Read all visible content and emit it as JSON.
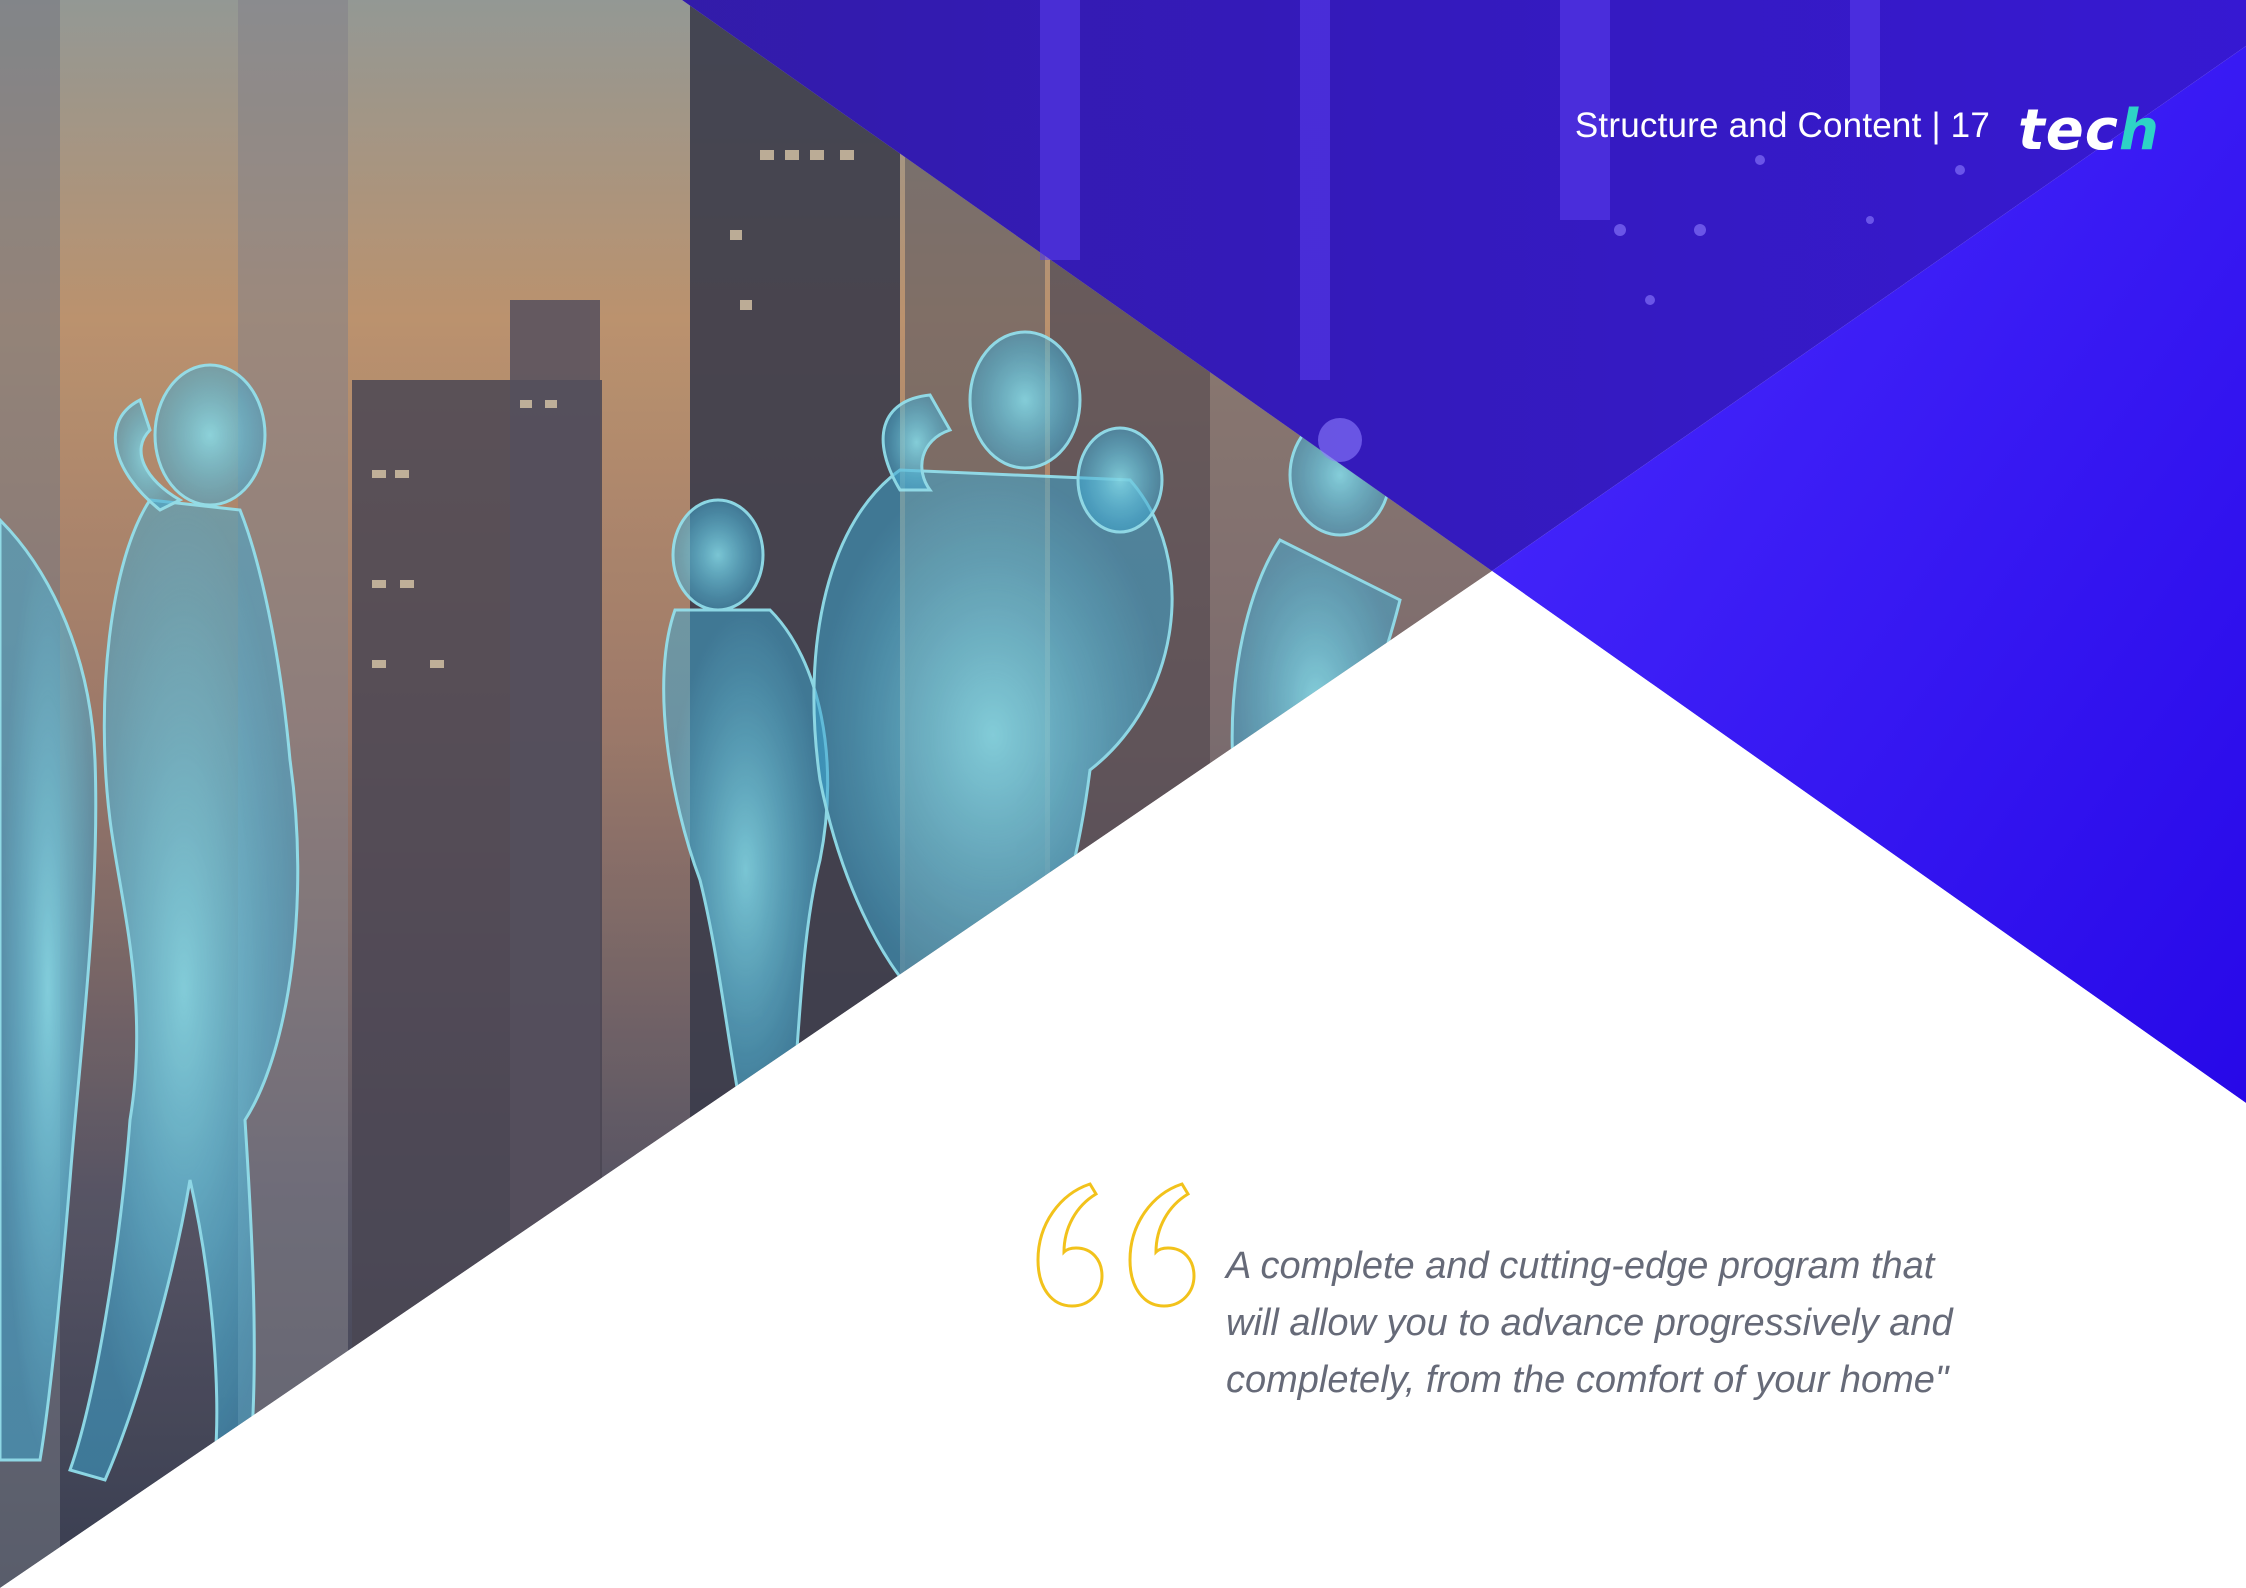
{
  "header": {
    "section_title": "Structure and Content | 17",
    "logo_text": "tech",
    "logo_accent_color": "#2ed3c6"
  },
  "quote": {
    "text": "A complete and cutting-edge program that\nwill allow you to advance progressively and\ncompletely, from the comfort of your home\"",
    "quote_mark_color": "#f2c21b"
  },
  "colors": {
    "brand_blue": "#3a14f2",
    "brand_indigo": "#2a12a6",
    "background": "#ffffff",
    "quote_text": "#666a78"
  }
}
